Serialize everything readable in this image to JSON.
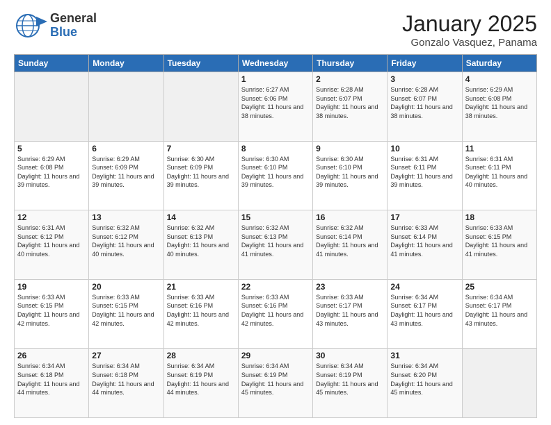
{
  "logo": {
    "general": "General",
    "blue": "Blue"
  },
  "title": "January 2025",
  "subtitle": "Gonzalo Vasquez, Panama",
  "weekdays": [
    "Sunday",
    "Monday",
    "Tuesday",
    "Wednesday",
    "Thursday",
    "Friday",
    "Saturday"
  ],
  "weeks": [
    [
      {
        "day": "",
        "info": ""
      },
      {
        "day": "",
        "info": ""
      },
      {
        "day": "",
        "info": ""
      },
      {
        "day": "1",
        "info": "Sunrise: 6:27 AM\nSunset: 6:06 PM\nDaylight: 11 hours and 38 minutes."
      },
      {
        "day": "2",
        "info": "Sunrise: 6:28 AM\nSunset: 6:07 PM\nDaylight: 11 hours and 38 minutes."
      },
      {
        "day": "3",
        "info": "Sunrise: 6:28 AM\nSunset: 6:07 PM\nDaylight: 11 hours and 38 minutes."
      },
      {
        "day": "4",
        "info": "Sunrise: 6:29 AM\nSunset: 6:08 PM\nDaylight: 11 hours and 38 minutes."
      }
    ],
    [
      {
        "day": "5",
        "info": "Sunrise: 6:29 AM\nSunset: 6:08 PM\nDaylight: 11 hours and 39 minutes."
      },
      {
        "day": "6",
        "info": "Sunrise: 6:29 AM\nSunset: 6:09 PM\nDaylight: 11 hours and 39 minutes."
      },
      {
        "day": "7",
        "info": "Sunrise: 6:30 AM\nSunset: 6:09 PM\nDaylight: 11 hours and 39 minutes."
      },
      {
        "day": "8",
        "info": "Sunrise: 6:30 AM\nSunset: 6:10 PM\nDaylight: 11 hours and 39 minutes."
      },
      {
        "day": "9",
        "info": "Sunrise: 6:30 AM\nSunset: 6:10 PM\nDaylight: 11 hours and 39 minutes."
      },
      {
        "day": "10",
        "info": "Sunrise: 6:31 AM\nSunset: 6:11 PM\nDaylight: 11 hours and 39 minutes."
      },
      {
        "day": "11",
        "info": "Sunrise: 6:31 AM\nSunset: 6:11 PM\nDaylight: 11 hours and 40 minutes."
      }
    ],
    [
      {
        "day": "12",
        "info": "Sunrise: 6:31 AM\nSunset: 6:12 PM\nDaylight: 11 hours and 40 minutes."
      },
      {
        "day": "13",
        "info": "Sunrise: 6:32 AM\nSunset: 6:12 PM\nDaylight: 11 hours and 40 minutes."
      },
      {
        "day": "14",
        "info": "Sunrise: 6:32 AM\nSunset: 6:13 PM\nDaylight: 11 hours and 40 minutes."
      },
      {
        "day": "15",
        "info": "Sunrise: 6:32 AM\nSunset: 6:13 PM\nDaylight: 11 hours and 41 minutes."
      },
      {
        "day": "16",
        "info": "Sunrise: 6:32 AM\nSunset: 6:14 PM\nDaylight: 11 hours and 41 minutes."
      },
      {
        "day": "17",
        "info": "Sunrise: 6:33 AM\nSunset: 6:14 PM\nDaylight: 11 hours and 41 minutes."
      },
      {
        "day": "18",
        "info": "Sunrise: 6:33 AM\nSunset: 6:15 PM\nDaylight: 11 hours and 41 minutes."
      }
    ],
    [
      {
        "day": "19",
        "info": "Sunrise: 6:33 AM\nSunset: 6:15 PM\nDaylight: 11 hours and 42 minutes."
      },
      {
        "day": "20",
        "info": "Sunrise: 6:33 AM\nSunset: 6:15 PM\nDaylight: 11 hours and 42 minutes."
      },
      {
        "day": "21",
        "info": "Sunrise: 6:33 AM\nSunset: 6:16 PM\nDaylight: 11 hours and 42 minutes."
      },
      {
        "day": "22",
        "info": "Sunrise: 6:33 AM\nSunset: 6:16 PM\nDaylight: 11 hours and 42 minutes."
      },
      {
        "day": "23",
        "info": "Sunrise: 6:33 AM\nSunset: 6:17 PM\nDaylight: 11 hours and 43 minutes."
      },
      {
        "day": "24",
        "info": "Sunrise: 6:34 AM\nSunset: 6:17 PM\nDaylight: 11 hours and 43 minutes."
      },
      {
        "day": "25",
        "info": "Sunrise: 6:34 AM\nSunset: 6:17 PM\nDaylight: 11 hours and 43 minutes."
      }
    ],
    [
      {
        "day": "26",
        "info": "Sunrise: 6:34 AM\nSunset: 6:18 PM\nDaylight: 11 hours and 44 minutes."
      },
      {
        "day": "27",
        "info": "Sunrise: 6:34 AM\nSunset: 6:18 PM\nDaylight: 11 hours and 44 minutes."
      },
      {
        "day": "28",
        "info": "Sunrise: 6:34 AM\nSunset: 6:19 PM\nDaylight: 11 hours and 44 minutes."
      },
      {
        "day": "29",
        "info": "Sunrise: 6:34 AM\nSunset: 6:19 PM\nDaylight: 11 hours and 45 minutes."
      },
      {
        "day": "30",
        "info": "Sunrise: 6:34 AM\nSunset: 6:19 PM\nDaylight: 11 hours and 45 minutes."
      },
      {
        "day": "31",
        "info": "Sunrise: 6:34 AM\nSunset: 6:20 PM\nDaylight: 11 hours and 45 minutes."
      },
      {
        "day": "",
        "info": ""
      }
    ]
  ]
}
